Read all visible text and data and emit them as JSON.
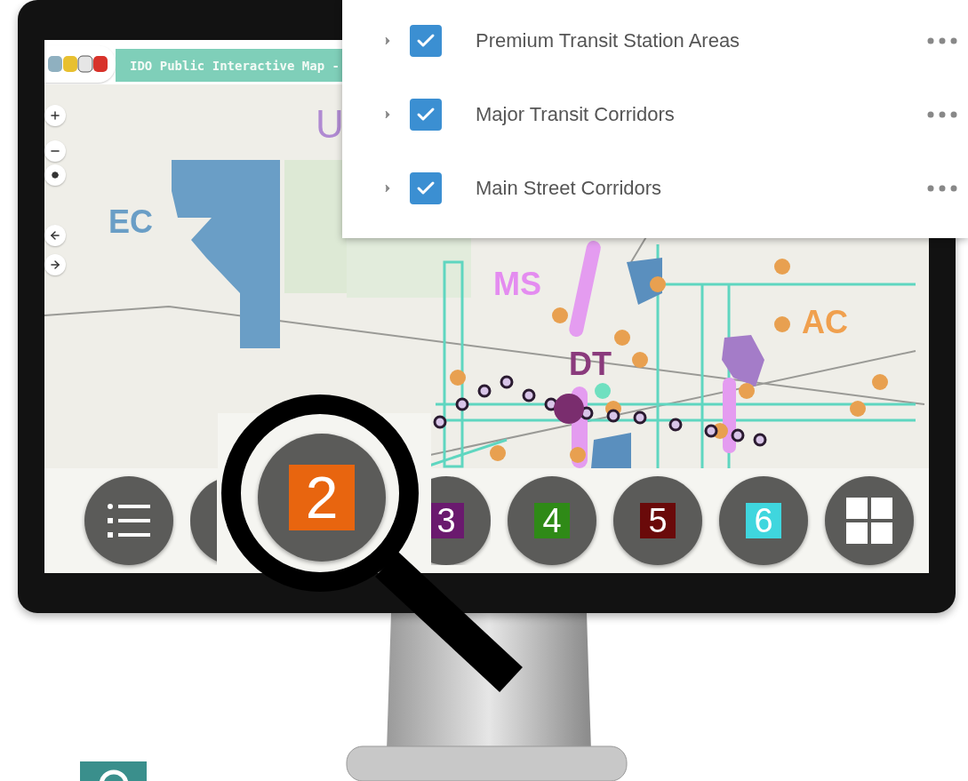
{
  "app": {
    "title": "IDO Public Interactive Map -"
  },
  "map_labels": [
    {
      "text": "EC",
      "color": "#6a9ec6"
    },
    {
      "text": "U",
      "color": "#b08ad2"
    },
    {
      "text": "MS",
      "color": "#e48cf0"
    },
    {
      "text": "DT",
      "color": "#8a3a7c"
    },
    {
      "text": "AC",
      "color": "#f0a04e"
    }
  ],
  "layers": [
    {
      "name": "Premium Transit Station Areas",
      "checked": true
    },
    {
      "name": "Major Transit Corridors",
      "checked": true
    },
    {
      "name": "Main Street Corridors",
      "checked": true
    }
  ],
  "toolbar": {
    "buttons": [
      {
        "kind": "list"
      },
      {
        "kind": "partial"
      },
      {
        "kind": "magnified",
        "label": "2",
        "color": "#e8650f"
      },
      {
        "kind": "number",
        "label": "3",
        "color": "#6a1a6e"
      },
      {
        "kind": "number",
        "label": "4",
        "color": "#2f8a17"
      },
      {
        "kind": "number",
        "label": "5",
        "color": "#6a0a0a"
      },
      {
        "kind": "number",
        "label": "6",
        "color": "#3fd6de"
      },
      {
        "kind": "grid"
      }
    ]
  }
}
